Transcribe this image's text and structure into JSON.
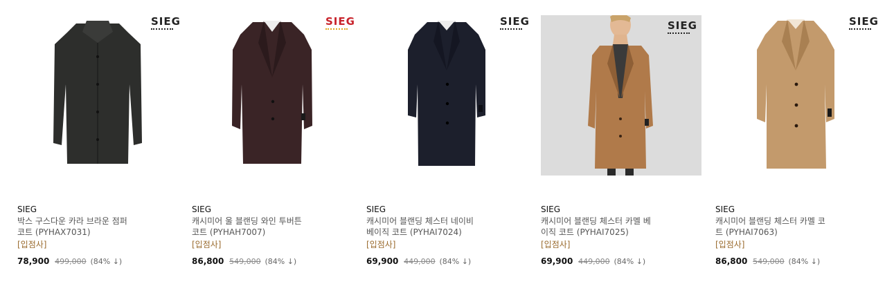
{
  "products": [
    {
      "brand": "SIEG",
      "logo": "SIEG",
      "name_line1": "박스 구스다운 카라 브라운 점퍼",
      "name_line2": "코트 (PYHAX7031)",
      "tag": "[입점사]",
      "price": "78,900",
      "original_price": "499,000",
      "discount": "(84% ↓)",
      "coat_color": "#2d2e2c",
      "photo": false,
      "logo_color": "#222222"
    },
    {
      "brand": "SIEG",
      "logo": "SIEG",
      "name_line1": "캐시미어 울 블랜딩 와인 투버튼",
      "name_line2": "코트 (PYHAH7007)",
      "tag": "[입점사]",
      "price": "86,800",
      "original_price": "549,000",
      "discount": "(84% ↓)",
      "coat_color": "#3a2426",
      "photo": false,
      "logo_color": "#c8232b"
    },
    {
      "brand": "SIEG",
      "logo": "SIEG",
      "name_line1": "캐시미어 블랜딩 체스터 네이비",
      "name_line2": "베이직 코트 (PYHAI7024)",
      "tag": "[입점사]",
      "price": "69,900",
      "original_price": "449,000",
      "discount": "(84% ↓)",
      "coat_color": "#1c1f2c",
      "photo": false,
      "logo_color": "#222222"
    },
    {
      "brand": "SIEG",
      "logo": "SIEG",
      "name_line1": "캐시미어 블랜딩 체스터 카멜 베",
      "name_line2": "이직 코트 (PYHAI7025)",
      "tag": "[입점사]",
      "price": "69,900",
      "original_price": "449,000",
      "discount": "(84% ↓)",
      "coat_color": "#b07a4a",
      "photo": true,
      "logo_color": "#222222"
    },
    {
      "brand": "SIEG",
      "logo": "SIEG",
      "name_line1": "캐시미어 블랜딩 체스터 카멜 코",
      "name_line2": "트 (PYHAI7063)",
      "tag": "[입점사]",
      "price": "86,800",
      "original_price": "549,000",
      "discount": "(84% ↓)",
      "coat_color": "#c39a6c",
      "photo": false,
      "logo_color": "#222222"
    }
  ]
}
